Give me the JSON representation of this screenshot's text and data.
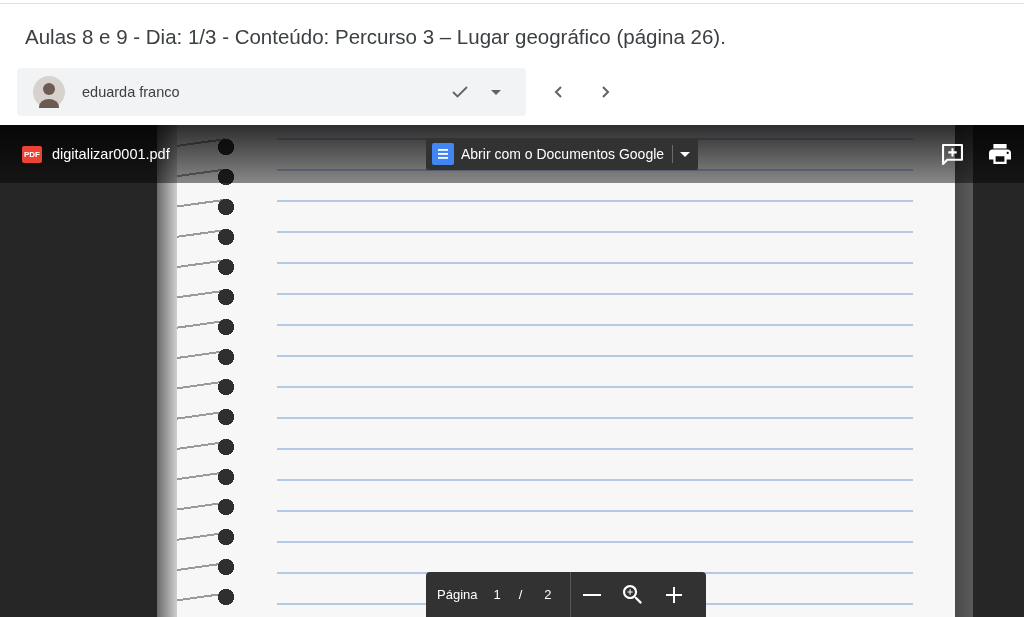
{
  "assignment": {
    "title": "Aulas 8 e 9 - Dia: 1/3 - Conteúdo: Percurso 3 – Lugar geográfico (página 26)."
  },
  "student": {
    "name": "eduarda franco"
  },
  "viewer": {
    "file_type": "PDF",
    "file_name": "digitalizar0001.pdf",
    "open_with_label": "Abrir com o Documentos Google",
    "page_control": {
      "label": "Página",
      "current": "1",
      "separator": "/",
      "total": "2"
    }
  }
}
